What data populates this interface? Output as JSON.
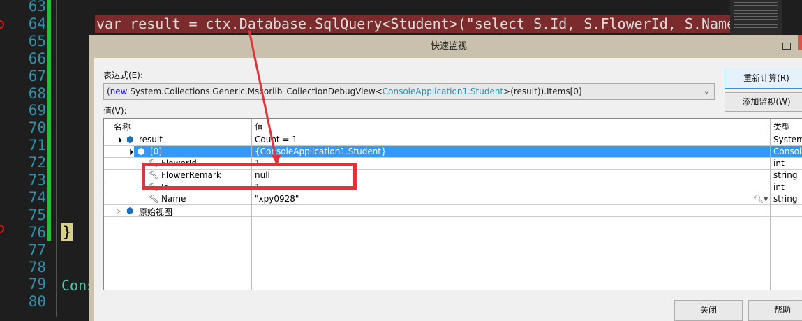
{
  "editor": {
    "line_numbers": [
      "63",
      "64",
      "65",
      "66",
      "67",
      "68",
      "69",
      "70",
      "71",
      "72",
      "73",
      "74",
      "75",
      "76",
      "77",
      "78",
      "79",
      "80"
    ],
    "line64": "var result = ctx.Database.SqlQuery<Student>(\"select S.Id, S.FlowerId, S.Name",
    "line76": "}",
    "line79": "Cons"
  },
  "dialog": {
    "title": "快速监视",
    "expression_label": "表达式(E):",
    "expression_parts": [
      "(",
      "new",
      " System.Collections.Generic.Mscorlib_CollectionDebugView<",
      "ConsoleApplication1.Student",
      ">(result)).Items[0]"
    ],
    "recalculate_button": "重新计算(R)",
    "add_watch_button": "添加监视(W)",
    "value_label": "值(V):",
    "columns": [
      "名称",
      "值",
      "类型"
    ],
    "rows": [
      {
        "name": "result",
        "value": "Count = 1",
        "type": "System."
      },
      {
        "name": "[0]",
        "value": "{ConsoleApplication1.Student}",
        "type": "Console"
      },
      {
        "name": "FlowerId",
        "value": "1",
        "type": "int"
      },
      {
        "name": "FlowerRemark",
        "value": "null",
        "type": "string"
      },
      {
        "name": "Id",
        "value": "1",
        "type": "int"
      },
      {
        "name": "Name",
        "value": "\"xpy0928\"",
        "type": "string"
      },
      {
        "name": "原始视图",
        "value": "",
        "type": ""
      }
    ],
    "close_button": "关闭",
    "help_button": "帮助"
  },
  "colors": {
    "highlight": "#7b2b2b",
    "selection": "#3399ff",
    "annotation": "#e53238"
  }
}
